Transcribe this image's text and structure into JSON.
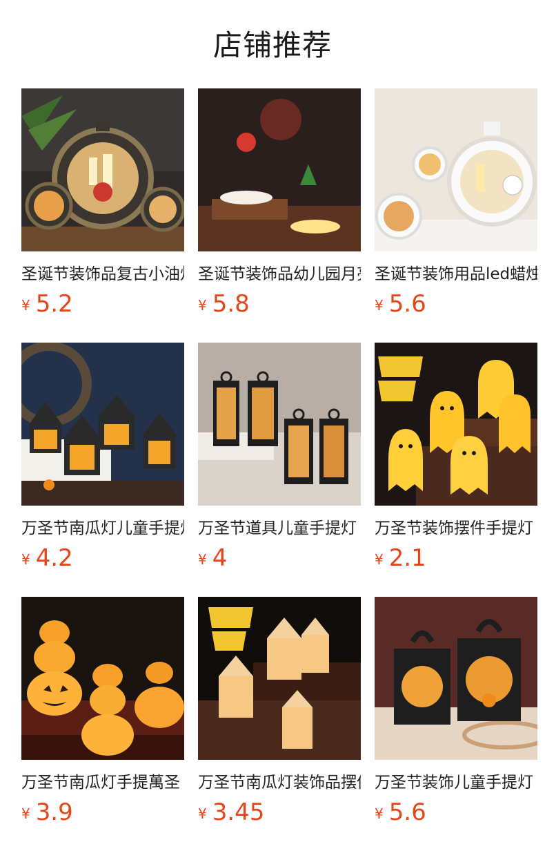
{
  "header": {
    "title": "店铺推荐"
  },
  "products": [
    {
      "name": "圣诞节装饰品复古小油灯",
      "currency": "¥",
      "price": "5.2",
      "image_icon": "christmas-round-lantern-image"
    },
    {
      "name": "圣诞节装饰品幼儿园月亮灯",
      "currency": "¥",
      "price": "5.8",
      "image_icon": "christmas-moon-lamp-image"
    },
    {
      "name": "圣诞节装饰用品led蜡烛灯",
      "currency": "¥",
      "price": "5.6",
      "image_icon": "white-christmas-lantern-image"
    },
    {
      "name": "万圣节南瓜灯儿童手提灯",
      "currency": "¥",
      "price": "4.2",
      "image_icon": "halloween-house-lantern-image"
    },
    {
      "name": "万圣节道具儿童手提灯",
      "currency": "¥",
      "price": "4",
      "image_icon": "halloween-black-lantern-image"
    },
    {
      "name": "万圣节装饰摆件手提灯",
      "currency": "¥",
      "price": "2.1",
      "image_icon": "halloween-ghost-lamp-image"
    },
    {
      "name": "万圣节南瓜灯手提萬圣",
      "currency": "¥",
      "price": "3.9",
      "image_icon": "pumpkin-stack-lamp-image"
    },
    {
      "name": "万圣节南瓜灯装饰品摆件",
      "currency": "¥",
      "price": "3.45",
      "image_icon": "halloween-party-lantern-image"
    },
    {
      "name": "万圣节装饰儿童手提灯",
      "currency": "¥",
      "price": "5.6",
      "image_icon": "halloween-square-lantern-image"
    }
  ]
}
